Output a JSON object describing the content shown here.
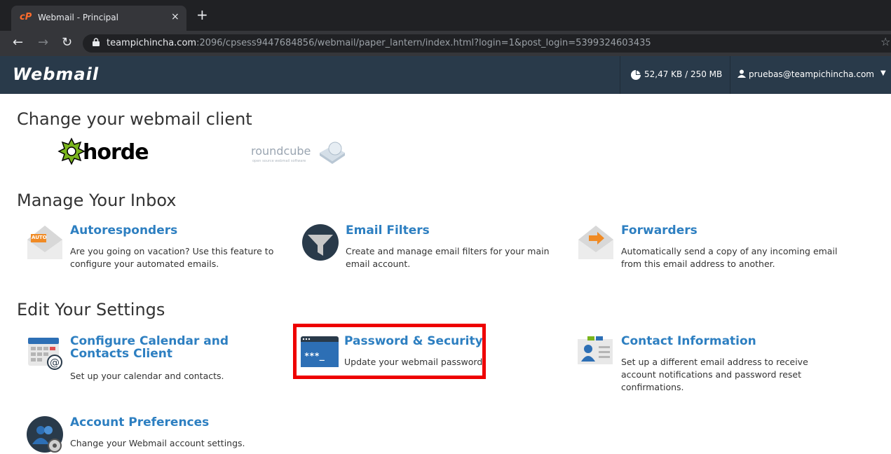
{
  "browser": {
    "tab_title": "Webmail - Principal",
    "tab_favicon": "cP",
    "tab_close": "×",
    "new_tab": "+",
    "url_host": "teampichincha.com",
    "url_rest": ":2096/cpsess9447684856/webmail/paper_lantern/index.html?login=1&post_login=5399324603435",
    "icons": [
      "back-icon",
      "forward-icon",
      "reload-icon",
      "lock-icon",
      "star-icon"
    ]
  },
  "header": {
    "logo": "Webmail",
    "quota": "52,47 KB / 250 MB",
    "user": "pruebas@teampichincha.com"
  },
  "sections": {
    "change_client": "Change your webmail client",
    "manage_inbox": "Manage Your Inbox",
    "edit_settings": "Edit Your Settings"
  },
  "clients": {
    "horde": "horde",
    "roundcube": "roundcube",
    "roundcube_tagline": "open source webmail software"
  },
  "inbox": [
    {
      "title": "Autoresponders",
      "desc": "Are you going on vacation? Use this feature to configure your automated emails.",
      "icon": "autoresponder-envelope-icon",
      "badge": "AUTO"
    },
    {
      "title": "Email Filters",
      "desc": "Create and manage email filters for your main email account.",
      "icon": "funnel-filter-icon"
    },
    {
      "title": "Forwarders",
      "desc": "Automatically send a copy of any incoming email from this email address to another.",
      "icon": "forward-envelope-icon"
    }
  ],
  "settings": [
    {
      "title": "Configure Calendar and Contacts Client",
      "desc": "Set up your calendar and contacts.",
      "icon": "calendar-at-icon"
    },
    {
      "title": "Password & Security",
      "desc": "Update your webmail password",
      "icon": "password-terminal-icon",
      "mask": "***_"
    },
    {
      "title": "Contact Information",
      "desc": "Set up a different email address to receive account notifications and password reset confirmations.",
      "icon": "contact-card-icon"
    },
    {
      "title": "Account Preferences",
      "desc": "Change your Webmail account settings.",
      "icon": "users-gear-icon"
    }
  ],
  "colors": {
    "header_bg": "#293a4a",
    "link": "#2d7fc1",
    "highlight": "#ee0000"
  }
}
